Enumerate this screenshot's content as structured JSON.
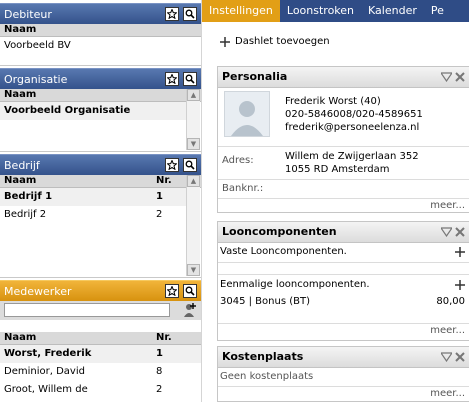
{
  "debiteur": {
    "title": "Debiteur",
    "col_naam": "Naam",
    "rows": [
      "Voorbeeld BV"
    ]
  },
  "organisatie": {
    "title": "Organisatie",
    "col_naam": "Naam",
    "rows": [
      "Voorbeeld Organisatie"
    ]
  },
  "bedrijf": {
    "title": "Bedrijf",
    "col_naam": "Naam",
    "col_nr": "Nr.",
    "rows": [
      {
        "naam": "Bedrijf 1",
        "nr": "1"
      },
      {
        "naam": "Bedrijf 2",
        "nr": "2"
      }
    ]
  },
  "medewerker": {
    "title": "Medewerker",
    "search_value": "",
    "col_naam": "Naam",
    "col_nr": "Nr.",
    "rows": [
      {
        "naam": "Worst, Frederik",
        "nr": "1"
      },
      {
        "naam": "Deminior, David",
        "nr": "8"
      },
      {
        "naam": "Groot, Willem de",
        "nr": "2"
      }
    ]
  },
  "tabs": [
    "Instellingen",
    "Loonstroken",
    "Kalender",
    "Pe"
  ],
  "add_dashlet": "Dashlet toevoegen",
  "personalia": {
    "title": "Personalia",
    "name": "Frederik Worst (40)",
    "phone": "020-5846008/020-4589651",
    "email": "frederik@personeelenza.nl",
    "adres_label": "Adres:",
    "adres_line1": "Willem de Zwijgerlaan 352",
    "adres_line2": "1055 RD Amsterdam",
    "bank_label": "Banknr.:",
    "more": "meer..."
  },
  "looncomponenten": {
    "title": "Looncomponenten",
    "vaste": "Vaste Looncomponenten.",
    "eenmalige": "Eenmalige looncomponenten.",
    "item_desc": "3045 | Bonus (BT)",
    "item_amount": "80,00",
    "more": "meer..."
  },
  "kostenplaats": {
    "title": "Kostenplaats",
    "empty": "Geen kostenplaats",
    "more": "meer..."
  },
  "colors": {
    "blue": "#34528b",
    "orange": "#e29f16"
  }
}
